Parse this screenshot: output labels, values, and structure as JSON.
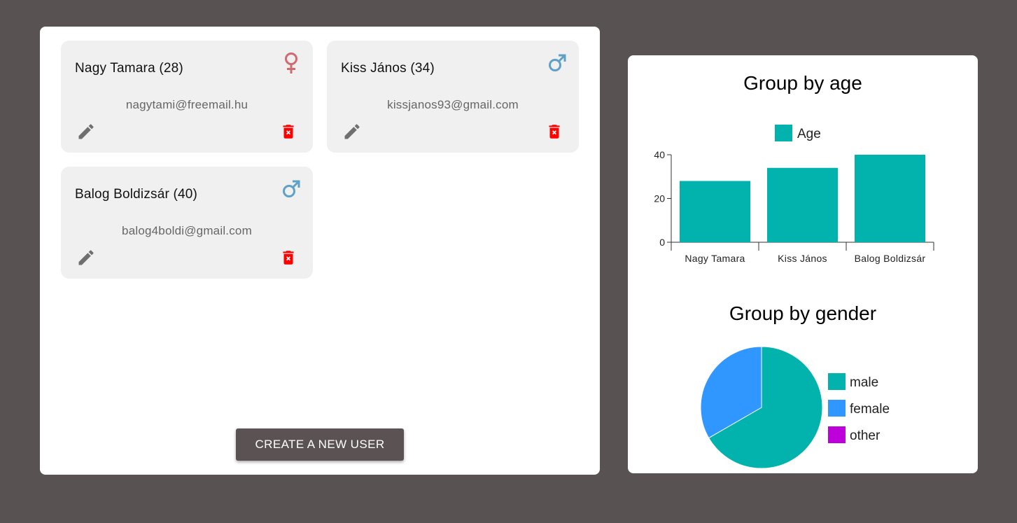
{
  "users": [
    {
      "name": "Nagy Tamara (28)",
      "email": "nagytami@freemail.hu",
      "gender": "female",
      "gender_icon": "female-symbol-icon"
    },
    {
      "name": "Kiss János (34)",
      "email": "kissjanos93@gmail.com",
      "gender": "male",
      "gender_icon": "male-symbol-icon"
    },
    {
      "name": "Balog Boldizsár (40)",
      "email": "balog4boldi@gmail.com",
      "gender": "male",
      "gender_icon": "male-symbol-icon"
    }
  ],
  "actions": {
    "edit_icon": "pencil-icon",
    "delete_icon": "trash-icon"
  },
  "create_button_label": "CREATE A NEW USER",
  "colors": {
    "female": "#d16a6f",
    "male": "#5fa0c9",
    "delete": "#ff0000",
    "edit": "#6f6f6f",
    "teal": "#02b3ad",
    "blue": "#2f97ff",
    "purple": "#bd00d9"
  },
  "chart_data": [
    {
      "type": "bar",
      "title": "Group by age",
      "categories": [
        "Nagy Tamara",
        "Kiss János",
        "Balog Boldizsár"
      ],
      "series": [
        {
          "name": "Age",
          "values": [
            28,
            34,
            40
          ],
          "color": "#02b3ad"
        }
      ],
      "ylim": [
        0,
        40
      ],
      "yticks": [
        0,
        20,
        40
      ],
      "legend": "top",
      "grid": false
    },
    {
      "type": "pie",
      "title": "Group by gender",
      "labels": [
        "male",
        "female",
        "other"
      ],
      "values": [
        2,
        1,
        0
      ],
      "colors": [
        "#02b3ad",
        "#2f97ff",
        "#bd00d9"
      ],
      "legend": "right"
    }
  ]
}
